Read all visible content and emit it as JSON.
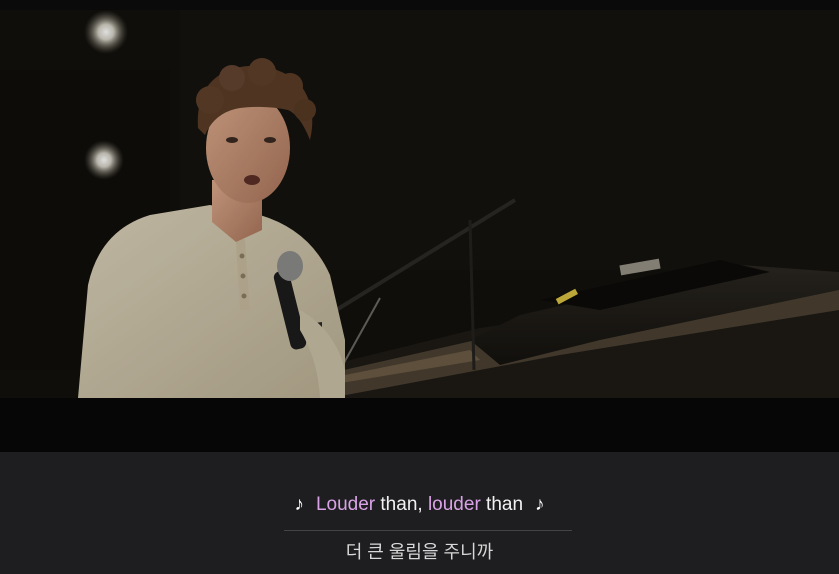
{
  "subtitles": {
    "line1": {
      "note_left": "♪",
      "word1": "Louder",
      "text1": " than, ",
      "word2": "louder",
      "text2": " than",
      "note_right": "♪"
    },
    "line2": "더 큰 울림을 주니까"
  },
  "colors": {
    "highlight": "#d9a2e6",
    "subtitle_text": "#f2f2f2",
    "translation_text": "#d8d8d8",
    "subtitle_background": "#1e1e20"
  }
}
